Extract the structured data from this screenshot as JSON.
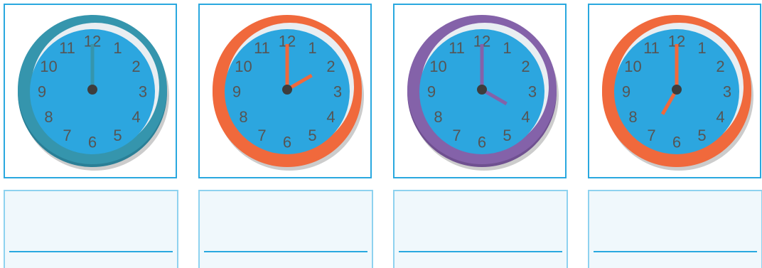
{
  "clocks": [
    {
      "name": "clock-12-00",
      "time": "12:00",
      "hour": 12,
      "minute": 0,
      "rim_color": "#3595ad",
      "rim_dark": "#2a7f96",
      "hand_color": "#3595ad"
    },
    {
      "name": "clock-2-00",
      "time": "2:00",
      "hour": 2,
      "minute": 0,
      "rim_color": "#f0693c",
      "rim_dark": "#f0693c",
      "hand_color": "#f0693c"
    },
    {
      "name": "clock-4-00",
      "time": "4:00",
      "hour": 4,
      "minute": 0,
      "rim_color": "#8462a9",
      "rim_dark": "#6f5090",
      "hand_color": "#8462a9"
    },
    {
      "name": "clock-7-00",
      "time": "7:00",
      "hour": 7,
      "minute": 0,
      "rim_color": "#f0693c",
      "rim_dark": "#f0693c",
      "hand_color": "#f0693c"
    }
  ],
  "face_color": "#2ca6df",
  "numerals": [
    "12",
    "1",
    "2",
    "3",
    "4",
    "5",
    "6",
    "7",
    "8",
    "9",
    "10",
    "11"
  ],
  "answers": [
    "",
    "",
    "",
    ""
  ]
}
